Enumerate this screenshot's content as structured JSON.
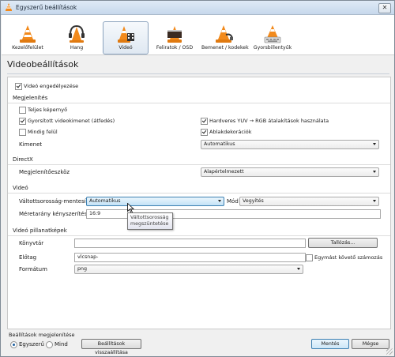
{
  "window": {
    "title": "Egyszerű beállítások",
    "close_glyph": "✕"
  },
  "toolbar": {
    "items": [
      {
        "label": "Kezelőfelület",
        "icon": "cone-icon"
      },
      {
        "label": "Hang",
        "icon": "headphones-cone-icon"
      },
      {
        "label": "Videó",
        "icon": "film-cone-icon",
        "active": true
      },
      {
        "label": "Feliratok / OSD",
        "icon": "clapper-cone-icon"
      },
      {
        "label": "Bemenet / kodekek",
        "icon": "cable-cone-icon"
      },
      {
        "label": "Gyorsbillentyűk",
        "icon": "keyboard-cone-icon"
      }
    ]
  },
  "page": {
    "title": "Videobeállítások"
  },
  "video_enable": {
    "label": "Videó engedélyezése",
    "checked": true
  },
  "display": {
    "header": "Megjelenítés",
    "fullscreen": {
      "label": "Teljes képernyő",
      "checked": false
    },
    "overlay": {
      "label": "Gyorsított videokimenet (átfedés)",
      "checked": true
    },
    "always_on_top": {
      "label": "Mindig felül",
      "checked": false
    },
    "hw_yuv": {
      "label": "Hardveres YUV → RGB átalakítások használata",
      "checked": true
    },
    "decorations": {
      "label": "Ablakdekorációk",
      "checked": true
    },
    "output_label": "Kimenet",
    "output_value": "Automatikus"
  },
  "directx": {
    "header": "DirectX",
    "device_label": "Megjelenítőeszköz",
    "device_value": "Alapértelmezett"
  },
  "video": {
    "header": "Videó",
    "deinterlace_label": "Váltottsorosság-mentesítés",
    "deinterlace_value": "Automatikus",
    "mode_label": "Mód",
    "mode_value": "Vegyítés",
    "aspect_label": "Méretarány kényszerítése",
    "aspect_value": "16:9"
  },
  "tooltip": {
    "line1": "Váltottsorosság",
    "line2": "megszüntetése"
  },
  "snapshots": {
    "header": "Videó pillanatképek",
    "dir_label": "Könyvtár",
    "dir_value": "",
    "browse_label": "Tallózás...",
    "prefix_label": "Előtag",
    "prefix_value": "vlcsnap-",
    "sequential_label": "Egymást követő számozás",
    "sequential_checked": false,
    "format_label": "Formátum",
    "format_value": "png"
  },
  "footer": {
    "show_settings_label": "Beállítások megjelenítése",
    "simple_label": "Egyszerű",
    "all_label": "Mind",
    "reset_label": "Beállítások visszaállítása",
    "save_label": "Mentés",
    "cancel_label": "Mégse"
  },
  "colors": {
    "accent": "#3c7fb1",
    "cone_orange": "#f28a1c"
  }
}
